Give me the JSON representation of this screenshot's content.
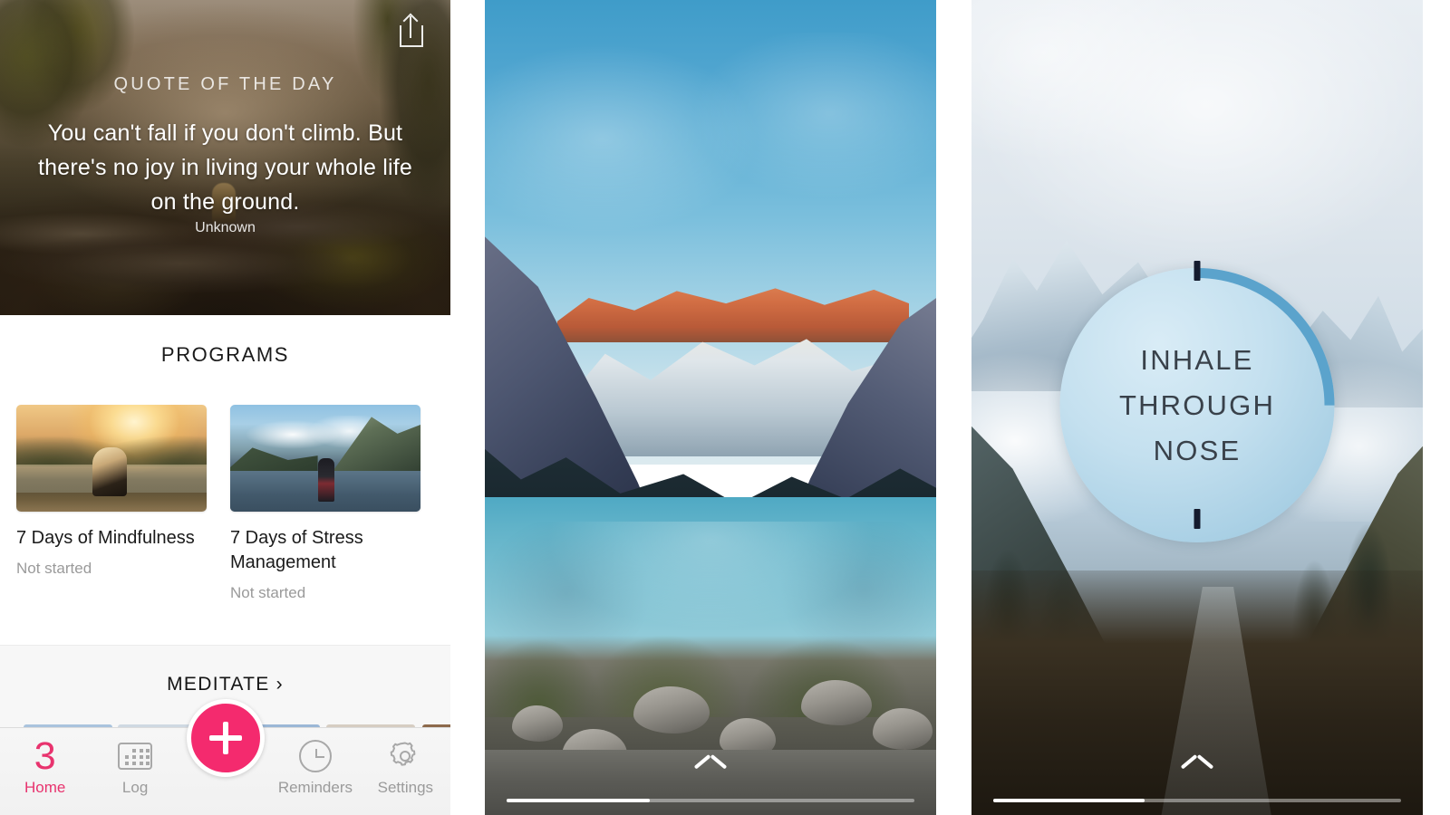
{
  "app": {
    "accent_pink": "#E8336E",
    "fab_pink": "#F42A6E"
  },
  "home_screen": {
    "share_icon": "share-icon",
    "quote_card": {
      "label": "QUOTE OF THE DAY",
      "text": "You can't fall if you don't climb. But there's no joy in living your whole life on the ground.",
      "author": "Unknown"
    },
    "programs": {
      "title": "PROGRAMS",
      "items": [
        {
          "title": "7 Days of Mindfulness",
          "status": "Not started",
          "thumb": "woman-at-sunset-lake"
        },
        {
          "title": "7 Days of Stress Management",
          "status": "Not started",
          "thumb": "person-at-mountain-lake"
        }
      ]
    },
    "meditate_section": {
      "label": "MEDITATE",
      "chevron": "›"
    },
    "tabbar": {
      "items": [
        {
          "label": "Home",
          "icon": "streak-number",
          "badge": "3",
          "active": true
        },
        {
          "label": "Log",
          "icon": "calendar-icon",
          "active": false
        },
        {
          "label": "Reminders",
          "icon": "clock-icon",
          "active": false
        },
        {
          "label": "Settings",
          "icon": "gear-icon",
          "active": false
        }
      ],
      "fab": {
        "icon": "plus-icon",
        "label": "+"
      }
    }
  },
  "photo_screen": {
    "scene": "lake-louise-sunrise",
    "chevron_icon": "chevron-up-icon",
    "progress_percent": 35
  },
  "breathe_screen": {
    "scene": "misty-mountain-valley",
    "instruction": "INHALE THROUGH NOSE",
    "instruction_lines": [
      "INHALE",
      "THROUGH",
      "NOSE"
    ],
    "ring_progress_percent": 25,
    "ring_color": "#5BA3CC",
    "circle_fill": "#C4E0EF",
    "tick_color": "#141B2E",
    "chevron_icon": "chevron-up-icon",
    "progress_percent": 37
  }
}
